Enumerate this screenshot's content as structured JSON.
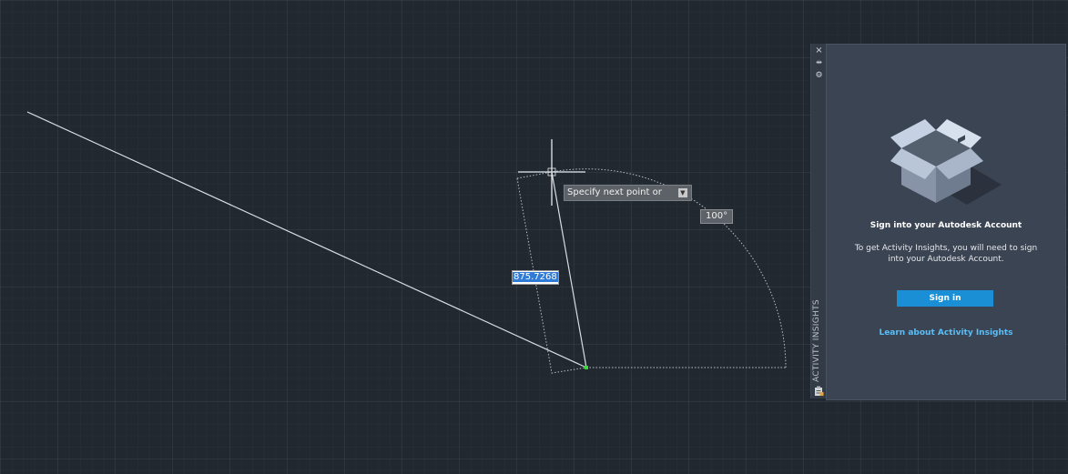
{
  "drawing": {
    "prompt_text": "Specify next point or",
    "prompt_dropdown_icon": "down-arrow-icon",
    "angle_value": "100°",
    "length_value": "875.7268",
    "colors": {
      "line": "#d9dde3",
      "dotted": "#b9bec6",
      "snap_point": "#3fd63f"
    }
  },
  "palette": {
    "controls": {
      "close_icon": "×",
      "autohide_icon": "⇹",
      "properties_icon": "⚙"
    },
    "vertical_title": "ACTIVITY INSIGHTS",
    "bottom_icon": "clipboard-icon",
    "heading": "Sign into your Autodesk Account",
    "description": "To get Activity Insights, you will need to sign into your Autodesk Account.",
    "signin_label": "Sign in",
    "learn_link": "Learn about Activity Insights",
    "accent_color": "#1a8fd6",
    "link_color": "#5bbdf5"
  }
}
